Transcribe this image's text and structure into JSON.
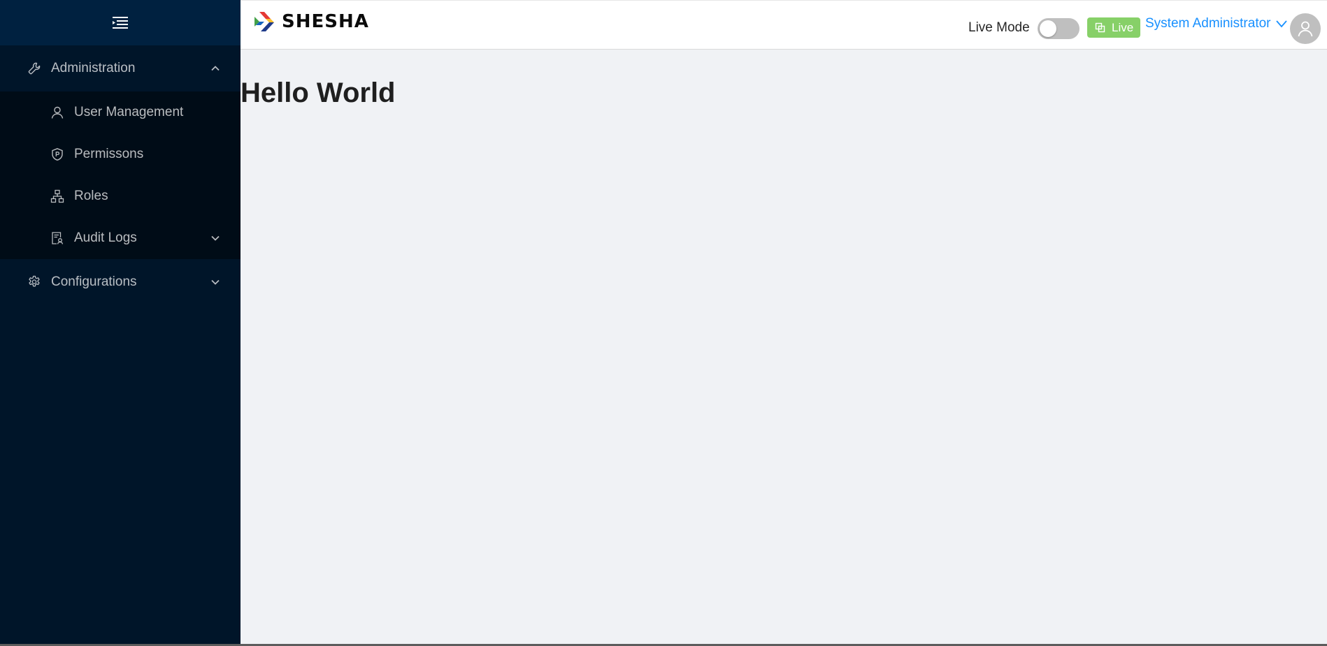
{
  "sidebar": {
    "menu": [
      {
        "label": "Administration",
        "icon": "wrench-icon",
        "expanded": true,
        "children": [
          {
            "label": "User Management",
            "icon": "user-icon"
          },
          {
            "label": "Permissons",
            "icon": "shield-icon"
          },
          {
            "label": "Roles",
            "icon": "hierarchy-icon"
          },
          {
            "label": "Audit Logs",
            "icon": "audit-icon",
            "has_children": true
          }
        ]
      },
      {
        "label": "Configurations",
        "icon": "gear-icon",
        "expanded": false
      }
    ]
  },
  "header": {
    "brand": "SHESHA",
    "live_mode_label": "Live Mode",
    "live_mode_on": false,
    "live_badge": "Live",
    "user_name": "System Administrator"
  },
  "main": {
    "title": "Hello World"
  },
  "colors": {
    "sidebar_bg": "#001529",
    "submenu_bg": "#000c17",
    "accent": "#1890ff",
    "live_badge": "#87d068"
  }
}
